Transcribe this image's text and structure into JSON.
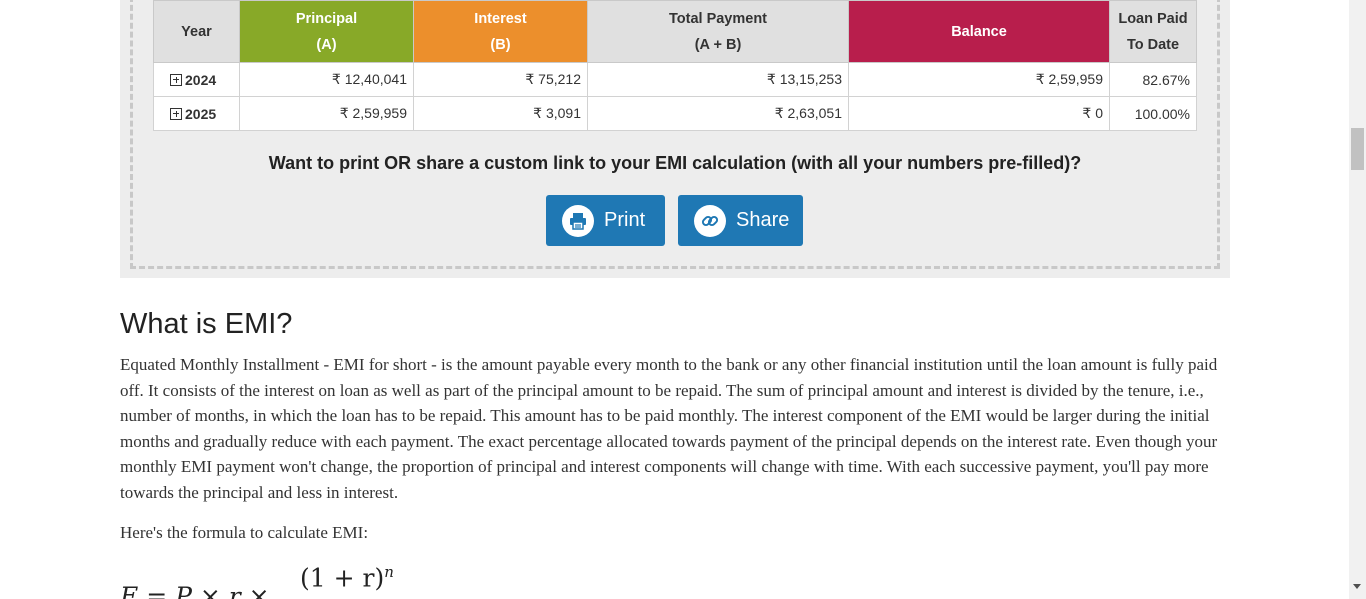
{
  "table": {
    "headers": {
      "year": "Year",
      "principal": "Principal",
      "principal_sub": "(A)",
      "interest": "Interest",
      "interest_sub": "(B)",
      "total": "Total Payment",
      "total_sub": "(A + B)",
      "balance": "Balance",
      "paid": "Loan Paid",
      "paid_sub": "To Date"
    },
    "rows": [
      {
        "year": "2024",
        "principal": "₹ 12,40,041",
        "interest": "₹ 75,212",
        "total": "₹ 13,15,253",
        "balance": "₹ 2,59,959",
        "paid": "82.67%"
      },
      {
        "year": "2025",
        "principal": "₹ 2,59,959",
        "interest": "₹ 3,091",
        "total": "₹ 2,63,051",
        "balance": "₹ 0",
        "paid": "100.00%"
      }
    ]
  },
  "share_prompt": "Want to print OR share a custom link to your EMI calculation (with all your numbers pre-filled)?",
  "buttons": {
    "print": "Print",
    "share": "Share"
  },
  "icons": {
    "print": "printer-icon",
    "share": "link-icon",
    "expand": "plus-square-icon"
  },
  "colors": {
    "principal": "#88a928",
    "interest": "#ec8f2c",
    "balance": "#b81e4c",
    "button": "#1f78b4"
  },
  "article": {
    "title": "What is EMI?",
    "body": "Equated Monthly Installment - EMI for short - is the amount payable every month to the bank or any other financial institution until the loan amount is fully paid off. It consists of the interest on loan as well as part of the principal amount to be repaid. The sum of principal amount and interest is divided by the tenure, i.e., number of months, in which the loan has to be repaid. This amount has to be paid monthly. The interest component of the EMI would be larger during the initial months and gradually reduce with each payment. The exact percentage allocated towards payment of the principal depends on the interest rate. Even though your monthly EMI payment won't change, the proportion of principal and interest components will change with time. With each successive payment, you'll pay more towards the principal and less in interest.",
    "formula_intro": "Here's the formula to calculate EMI:",
    "formula_lhs": "E = P × r ×",
    "formula_numerator": "(1 + r)",
    "formula_exponent": "n"
  }
}
